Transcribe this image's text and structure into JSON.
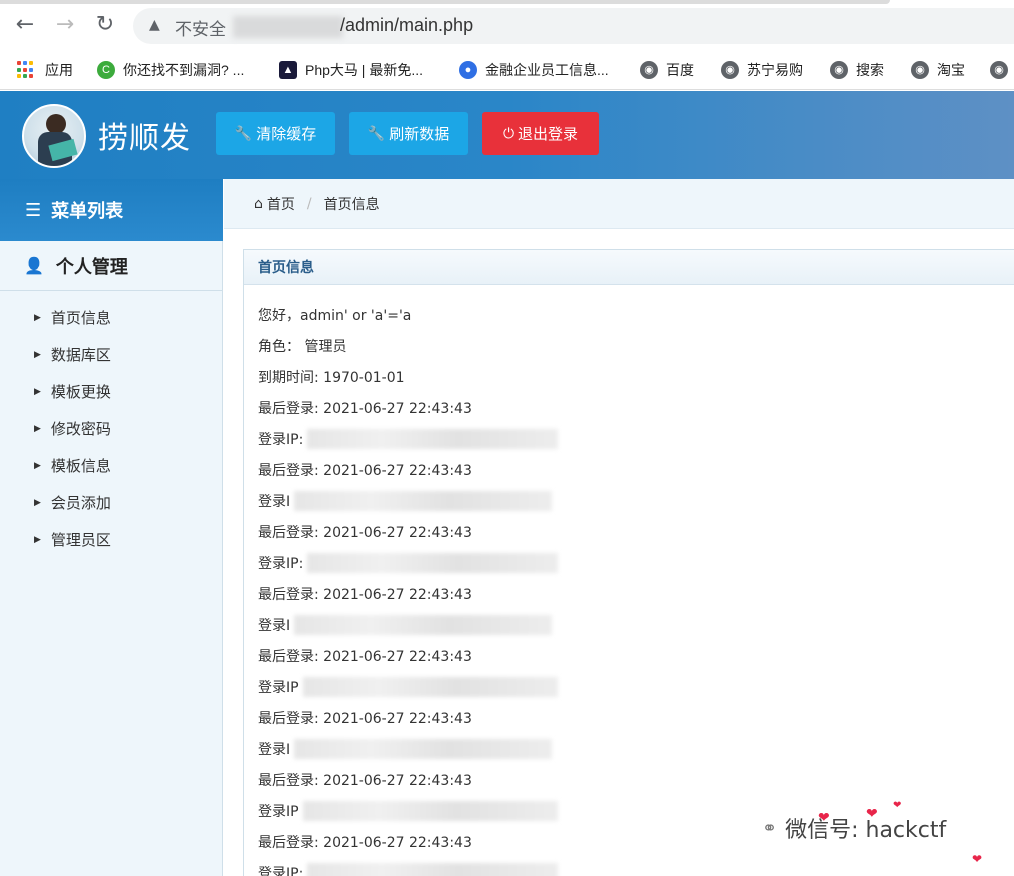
{
  "browser": {
    "insecure_label": "不安全",
    "url_path": "/admin/main.php",
    "bookmarks": [
      {
        "label": "应用"
      },
      {
        "label": "你还找不到漏洞? ..."
      },
      {
        "label": "Php大马 | 最新免..."
      },
      {
        "label": "金融企业员工信息..."
      },
      {
        "label": "百度"
      },
      {
        "label": "苏宁易购"
      },
      {
        "label": "搜索"
      },
      {
        "label": "淘宝"
      }
    ]
  },
  "header": {
    "title": "捞顺发",
    "buttons": {
      "clear_cache": "清除缓存",
      "refresh_data": "刷新数据",
      "logout": "退出登录"
    }
  },
  "sidebar": {
    "menu_title": "菜单列表",
    "group_title": "个人管理",
    "items": [
      {
        "label": "首页信息"
      },
      {
        "label": "数据库区"
      },
      {
        "label": "模板更换"
      },
      {
        "label": "修改密码"
      },
      {
        "label": "模板信息"
      },
      {
        "label": "会员添加"
      },
      {
        "label": "管理员区"
      }
    ]
  },
  "breadcrumb": {
    "home": "首页",
    "current": "首页信息"
  },
  "panel": {
    "title": "首页信息",
    "lines": [
      "您好，admin' or 'a'='a",
      "角色： 管理员",
      "到期时间: 1970-01-01",
      "最后登录: 2021-06-27 22:43:43",
      "登录IP:",
      "最后登录: 2021-06-27 22:43:43",
      "登录I",
      "最后登录: 2021-06-27 22:43:43",
      "登录IP:",
      "最后登录: 2021-06-27 22:43:43",
      "登录I",
      "最后登录: 2021-06-27 22:43:43",
      "登录IP",
      "最后登录: 2021-06-27 22:43:43",
      "登录I",
      "最后登录: 2021-06-27 22:43:43",
      "登录IP",
      "最后登录: 2021-06-27 22:43:43",
      "登录IP:"
    ]
  },
  "watermark": {
    "text": "微信号: hackctf"
  }
}
